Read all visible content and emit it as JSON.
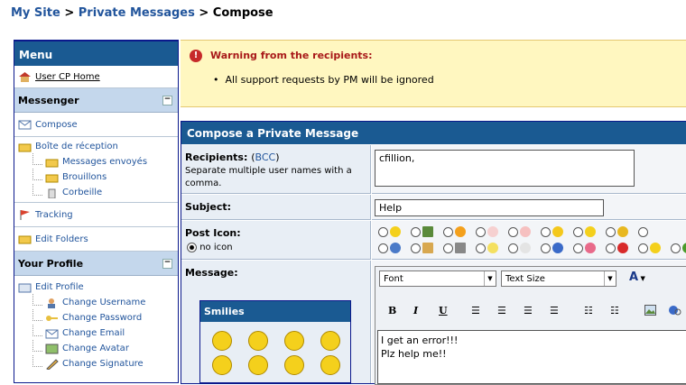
{
  "breadcrumb": {
    "site": "My Site",
    "sep1": ">",
    "pm": "Private Messages",
    "sep2": ">",
    "current": "Compose"
  },
  "sidebar": {
    "menu_title": "Menu",
    "usercp": "User CP Home",
    "messenger_title": "Messenger",
    "collapse": "−",
    "compose": "Compose",
    "inbox": "Boîte de réception",
    "folders": [
      "Messages envoyés",
      "Brouillons",
      "Corbeille"
    ],
    "tracking": "Tracking",
    "edit_folders": "Edit Folders",
    "profile_title": "Your Profile",
    "edit_profile": "Edit Profile",
    "profile_items": [
      "Change Username",
      "Change Password",
      "Change Email",
      "Change Avatar",
      "Change Signature"
    ]
  },
  "warning": {
    "title": "Warning from the recipients:",
    "item": "All support requests by PM will be ignored"
  },
  "compose": {
    "header": "Compose a Private Message",
    "recipients_label": "Recipients:",
    "bcc": "BCC",
    "recipients_note": "Separate multiple user names with a comma.",
    "recipients_value": "cfillion,",
    "subject_label": "Subject:",
    "subject_value": "Help",
    "post_icon_label": "Post Icon:",
    "no_icon": "no icon",
    "message_label": "Message:",
    "smilies_title": "Smilies",
    "font_select": "Font",
    "size_select": "Text Size",
    "message_lines": [
      "I get an error!!!",
      "Plz help me!!"
    ]
  },
  "colors": {
    "header_blue": "#1a5a92",
    "warning_bg": "#fff7c0",
    "warning_text": "#a81818"
  }
}
